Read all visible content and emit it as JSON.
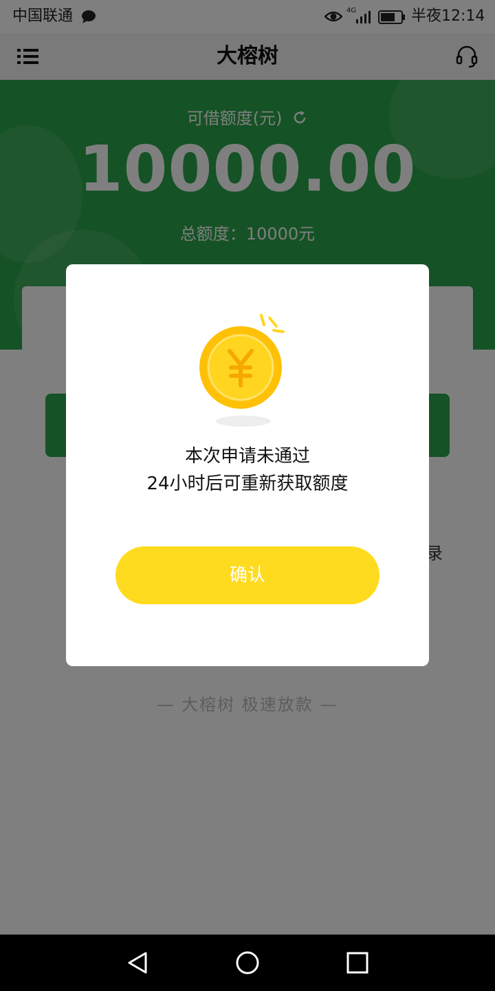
{
  "status_bar": {
    "carrier": "中国联通",
    "time": "半夜12:14",
    "network": "4G"
  },
  "header": {
    "title": "大榕树",
    "menu_icon": "menu-list-icon",
    "support_icon": "headset-icon"
  },
  "hero": {
    "label": "可借额度(元)",
    "refresh_icon": "refresh-icon",
    "amount": "10000.00",
    "total": "总额度：10000元"
  },
  "card": {
    "side_text": "录"
  },
  "footer": {
    "note": "—  大榕树  极速放款  —"
  },
  "dialog": {
    "icon": "yuan-coin-icon",
    "line1": "本次申请未通过",
    "line2": "24小时后可重新获取额度",
    "confirm_label": "确认"
  },
  "navbar": {
    "back_icon": "back-triangle-icon",
    "home_icon": "home-circle-icon",
    "recents_icon": "recents-square-icon"
  },
  "colors": {
    "brand_green": "#2aa44a",
    "button_yellow": "#ffdb1f",
    "coin_gold": "#ffc107"
  }
}
